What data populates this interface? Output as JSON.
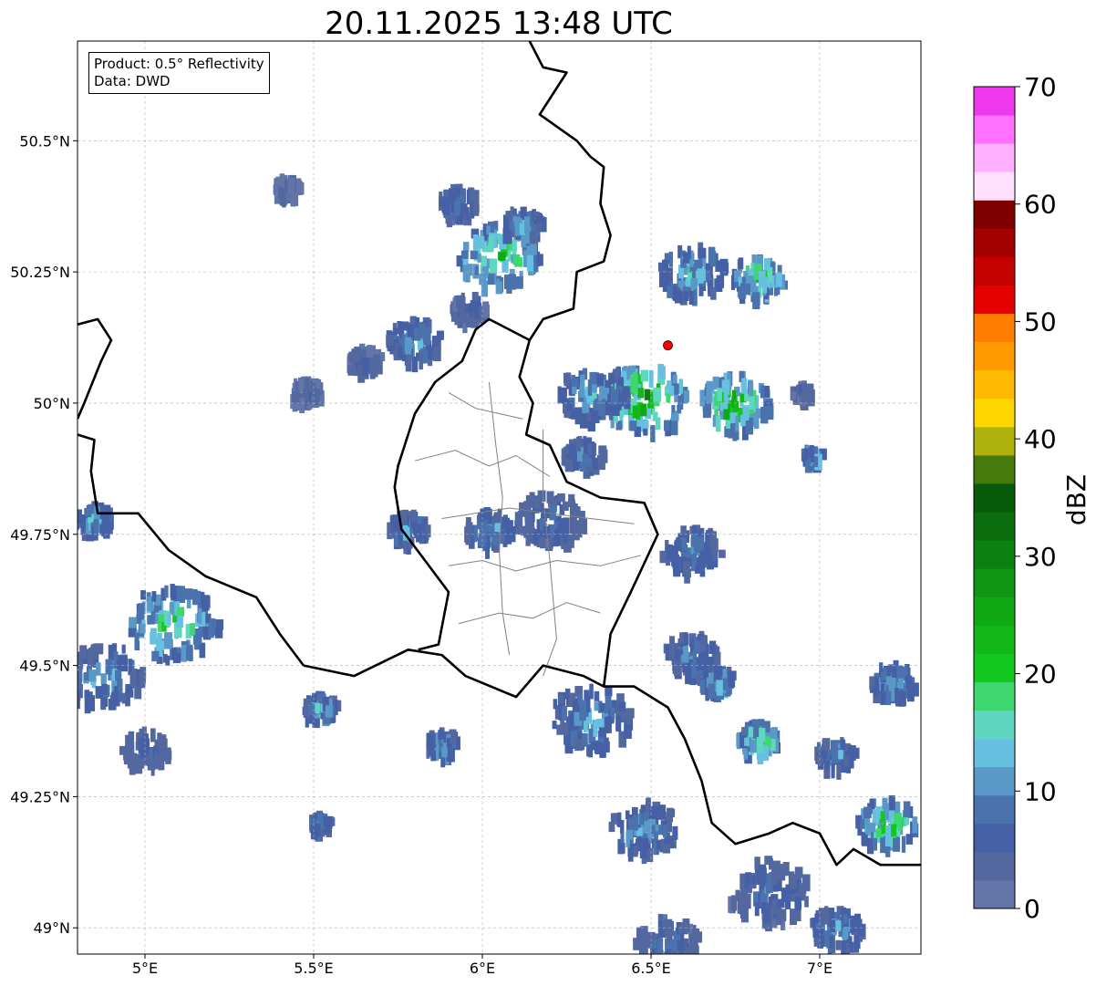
{
  "title": "20.11.2025 13:48 UTC",
  "info": {
    "product": "Product: 0.5° Reflectivity",
    "data": "Data: DWD"
  },
  "map": {
    "lon_range": [
      4.8,
      7.3
    ],
    "lat_range": [
      48.95,
      50.69
    ],
    "lon_ticks": [
      {
        "value": 5.0,
        "label": "5°E"
      },
      {
        "value": 5.5,
        "label": "5.5°E"
      },
      {
        "value": 6.0,
        "label": "6°E"
      },
      {
        "value": 6.5,
        "label": "6.5°E"
      },
      {
        "value": 7.0,
        "label": "7°E"
      }
    ],
    "lat_ticks": [
      {
        "value": 50.5,
        "label": "50.5°N"
      },
      {
        "value": 50.25,
        "label": "50.25°N"
      },
      {
        "value": 50.0,
        "label": "50°N"
      },
      {
        "value": 49.75,
        "label": "49.75°N"
      },
      {
        "value": 49.5,
        "label": "49.5°N"
      },
      {
        "value": 49.25,
        "label": "49.25°N"
      },
      {
        "value": 49.0,
        "label": "49°N"
      }
    ],
    "grid": true,
    "radar_site": {
      "lon": 6.55,
      "lat": 50.11,
      "color": "#ff0000"
    }
  },
  "colorbar": {
    "label": "dBZ",
    "range": [
      0,
      70
    ],
    "ticks": [
      0,
      10,
      20,
      30,
      40,
      50,
      60,
      70
    ],
    "colors": [
      "#6375a8",
      "#5468a0",
      "#4560a5",
      "#4a72ad",
      "#5a98c8",
      "#68c0e0",
      "#5fd6c0",
      "#3ed66e",
      "#12c81e",
      "#11b818",
      "#10a814",
      "#0f9612",
      "#0c8010",
      "#0a6e0e",
      "#075a0a",
      "#477a0c",
      "#aeb20a",
      "#fed700",
      "#ffb900",
      "#ff9b00",
      "#ff7e00",
      "#e50000",
      "#c40000",
      "#a30000",
      "#800000",
      "#ffe0ff",
      "#ffb0ff",
      "#ff70ff",
      "#ee38ee"
    ]
  },
  "echoes": [
    {
      "lon": 6.05,
      "lat": 50.28,
      "r": 0.12,
      "level": 25
    },
    {
      "lon": 5.93,
      "lat": 50.38,
      "r": 0.06,
      "level": 12
    },
    {
      "lon": 6.12,
      "lat": 50.34,
      "r": 0.06,
      "level": 15
    },
    {
      "lon": 5.96,
      "lat": 50.18,
      "r": 0.05,
      "level": 10
    },
    {
      "lon": 5.42,
      "lat": 50.41,
      "r": 0.04,
      "level": 6
    },
    {
      "lon": 5.8,
      "lat": 50.12,
      "r": 0.08,
      "level": 14
    },
    {
      "lon": 5.65,
      "lat": 50.08,
      "r": 0.05,
      "level": 8
    },
    {
      "lon": 5.48,
      "lat": 50.02,
      "r": 0.05,
      "level": 6
    },
    {
      "lon": 6.62,
      "lat": 50.25,
      "r": 0.1,
      "level": 18
    },
    {
      "lon": 6.82,
      "lat": 50.24,
      "r": 0.08,
      "level": 24
    },
    {
      "lon": 6.48,
      "lat": 50.01,
      "r": 0.13,
      "level": 30
    },
    {
      "lon": 6.75,
      "lat": 50.0,
      "r": 0.11,
      "level": 28
    },
    {
      "lon": 6.33,
      "lat": 50.02,
      "r": 0.1,
      "level": 16
    },
    {
      "lon": 6.3,
      "lat": 49.9,
      "r": 0.06,
      "level": 12
    },
    {
      "lon": 6.2,
      "lat": 49.78,
      "r": 0.1,
      "level": 10
    },
    {
      "lon": 6.02,
      "lat": 49.76,
      "r": 0.07,
      "level": 15
    },
    {
      "lon": 5.78,
      "lat": 49.76,
      "r": 0.06,
      "level": 14
    },
    {
      "lon": 6.62,
      "lat": 49.72,
      "r": 0.09,
      "level": 12
    },
    {
      "lon": 5.08,
      "lat": 49.58,
      "r": 0.14,
      "level": 22
    },
    {
      "lon": 4.88,
      "lat": 49.48,
      "r": 0.12,
      "level": 15
    },
    {
      "lon": 4.85,
      "lat": 49.78,
      "r": 0.05,
      "level": 18
    },
    {
      "lon": 5.0,
      "lat": 49.34,
      "r": 0.07,
      "level": 10
    },
    {
      "lon": 5.52,
      "lat": 49.42,
      "r": 0.05,
      "level": 18
    },
    {
      "lon": 5.88,
      "lat": 49.35,
      "r": 0.05,
      "level": 16
    },
    {
      "lon": 6.32,
      "lat": 49.4,
      "r": 0.12,
      "level": 14
    },
    {
      "lon": 6.62,
      "lat": 49.52,
      "r": 0.08,
      "level": 13
    },
    {
      "lon": 6.7,
      "lat": 49.47,
      "r": 0.05,
      "level": 18
    },
    {
      "lon": 6.82,
      "lat": 49.36,
      "r": 0.06,
      "level": 26
    },
    {
      "lon": 7.05,
      "lat": 49.33,
      "r": 0.06,
      "level": 14
    },
    {
      "lon": 7.2,
      "lat": 49.2,
      "r": 0.09,
      "level": 24
    },
    {
      "lon": 7.22,
      "lat": 49.47,
      "r": 0.07,
      "level": 16
    },
    {
      "lon": 6.48,
      "lat": 49.19,
      "r": 0.1,
      "level": 14
    },
    {
      "lon": 6.85,
      "lat": 49.07,
      "r": 0.12,
      "level": 10
    },
    {
      "lon": 6.55,
      "lat": 48.97,
      "r": 0.1,
      "level": 10
    },
    {
      "lon": 7.05,
      "lat": 49.0,
      "r": 0.08,
      "level": 14
    },
    {
      "lon": 5.52,
      "lat": 49.2,
      "r": 0.03,
      "level": 15
    },
    {
      "lon": 6.98,
      "lat": 49.9,
      "r": 0.03,
      "level": 20
    },
    {
      "lon": 6.95,
      "lat": 50.02,
      "r": 0.03,
      "level": 8
    }
  ],
  "borders": [
    [
      [
        6.14,
        50.69
      ],
      [
        6.18,
        50.64
      ],
      [
        6.25,
        50.63
      ],
      [
        6.17,
        50.55
      ],
      [
        6.28,
        50.5
      ],
      [
        6.32,
        50.47
      ],
      [
        6.36,
        50.45
      ],
      [
        6.35,
        50.38
      ],
      [
        6.38,
        50.32
      ],
      [
        6.36,
        50.27
      ],
      [
        6.28,
        50.25
      ],
      [
        6.27,
        50.18
      ],
      [
        6.18,
        50.16
      ],
      [
        6.14,
        50.12
      ],
      [
        6.11,
        50.05
      ],
      [
        6.15,
        50.0
      ],
      [
        6.13,
        49.94
      ],
      [
        6.2,
        49.92
      ],
      [
        6.25,
        49.85
      ],
      [
        6.35,
        49.82
      ],
      [
        6.48,
        49.81
      ],
      [
        6.52,
        49.75
      ],
      [
        6.44,
        49.64
      ],
      [
        6.38,
        49.56
      ],
      [
        6.36,
        49.46
      ],
      [
        6.3,
        49.48
      ],
      [
        6.18,
        49.5
      ],
      [
        6.1,
        49.44
      ],
      [
        5.95,
        49.48
      ],
      [
        5.88,
        49.52
      ],
      [
        5.78,
        49.53
      ],
      [
        5.62,
        49.48
      ],
      [
        5.47,
        49.5
      ]
    ],
    [
      [
        6.14,
        50.12
      ],
      [
        6.02,
        50.16
      ],
      [
        5.98,
        50.14
      ],
      [
        5.94,
        50.08
      ],
      [
        5.86,
        50.04
      ],
      [
        5.8,
        49.98
      ],
      [
        5.75,
        49.88
      ],
      [
        5.74,
        49.84
      ],
      [
        5.76,
        49.76
      ],
      [
        5.83,
        49.7
      ],
      [
        5.9,
        49.64
      ],
      [
        5.87,
        49.54
      ],
      [
        5.81,
        49.53
      ]
    ],
    [
      [
        5.47,
        49.5
      ],
      [
        5.4,
        49.56
      ],
      [
        5.33,
        49.63
      ],
      [
        5.18,
        49.67
      ],
      [
        5.07,
        49.72
      ],
      [
        4.98,
        49.79
      ],
      [
        4.86,
        49.79
      ],
      [
        4.84,
        49.87
      ],
      [
        4.85,
        49.93
      ],
      [
        4.8,
        49.94
      ]
    ],
    [
      [
        4.8,
        50.15
      ],
      [
        4.86,
        50.16
      ],
      [
        4.9,
        50.12
      ],
      [
        4.87,
        50.08
      ],
      [
        4.82,
        50.0
      ],
      [
        4.8,
        49.97
      ]
    ],
    [
      [
        6.36,
        49.46
      ],
      [
        6.45,
        49.46
      ],
      [
        6.55,
        49.42
      ],
      [
        6.6,
        49.36
      ],
      [
        6.65,
        49.28
      ],
      [
        6.68,
        49.2
      ],
      [
        6.75,
        49.16
      ],
      [
        6.85,
        49.18
      ],
      [
        6.92,
        49.2
      ],
      [
        7.0,
        49.18
      ],
      [
        7.05,
        49.12
      ],
      [
        7.1,
        49.15
      ],
      [
        7.18,
        49.12
      ],
      [
        7.25,
        49.12
      ],
      [
        7.3,
        49.12
      ]
    ]
  ],
  "admin_lines": [
    [
      [
        5.9,
        50.02
      ],
      [
        5.98,
        49.99
      ],
      [
        6.05,
        49.98
      ],
      [
        6.12,
        49.97
      ]
    ],
    [
      [
        5.8,
        49.89
      ],
      [
        5.92,
        49.91
      ],
      [
        6.02,
        49.88
      ],
      [
        6.1,
        49.9
      ],
      [
        6.2,
        49.86
      ]
    ],
    [
      [
        5.88,
        49.78
      ],
      [
        5.98,
        49.79
      ],
      [
        6.08,
        49.8
      ],
      [
        6.2,
        49.79
      ],
      [
        6.32,
        49.78
      ],
      [
        6.45,
        49.77
      ]
    ],
    [
      [
        5.9,
        49.69
      ],
      [
        6.0,
        49.7
      ],
      [
        6.1,
        49.68
      ],
      [
        6.22,
        49.7
      ],
      [
        6.35,
        49.69
      ],
      [
        6.47,
        49.71
      ]
    ],
    [
      [
        5.93,
        49.58
      ],
      [
        6.05,
        49.6
      ],
      [
        6.15,
        49.59
      ],
      [
        6.25,
        49.62
      ],
      [
        6.35,
        49.6
      ]
    ],
    [
      [
        6.02,
        50.04
      ],
      [
        6.04,
        49.92
      ],
      [
        6.06,
        49.82
      ],
      [
        6.05,
        49.72
      ],
      [
        6.06,
        49.6
      ],
      [
        6.08,
        49.52
      ]
    ],
    [
      [
        6.18,
        49.95
      ],
      [
        6.18,
        49.82
      ],
      [
        6.2,
        49.7
      ],
      [
        6.22,
        49.55
      ],
      [
        6.18,
        49.48
      ]
    ]
  ]
}
